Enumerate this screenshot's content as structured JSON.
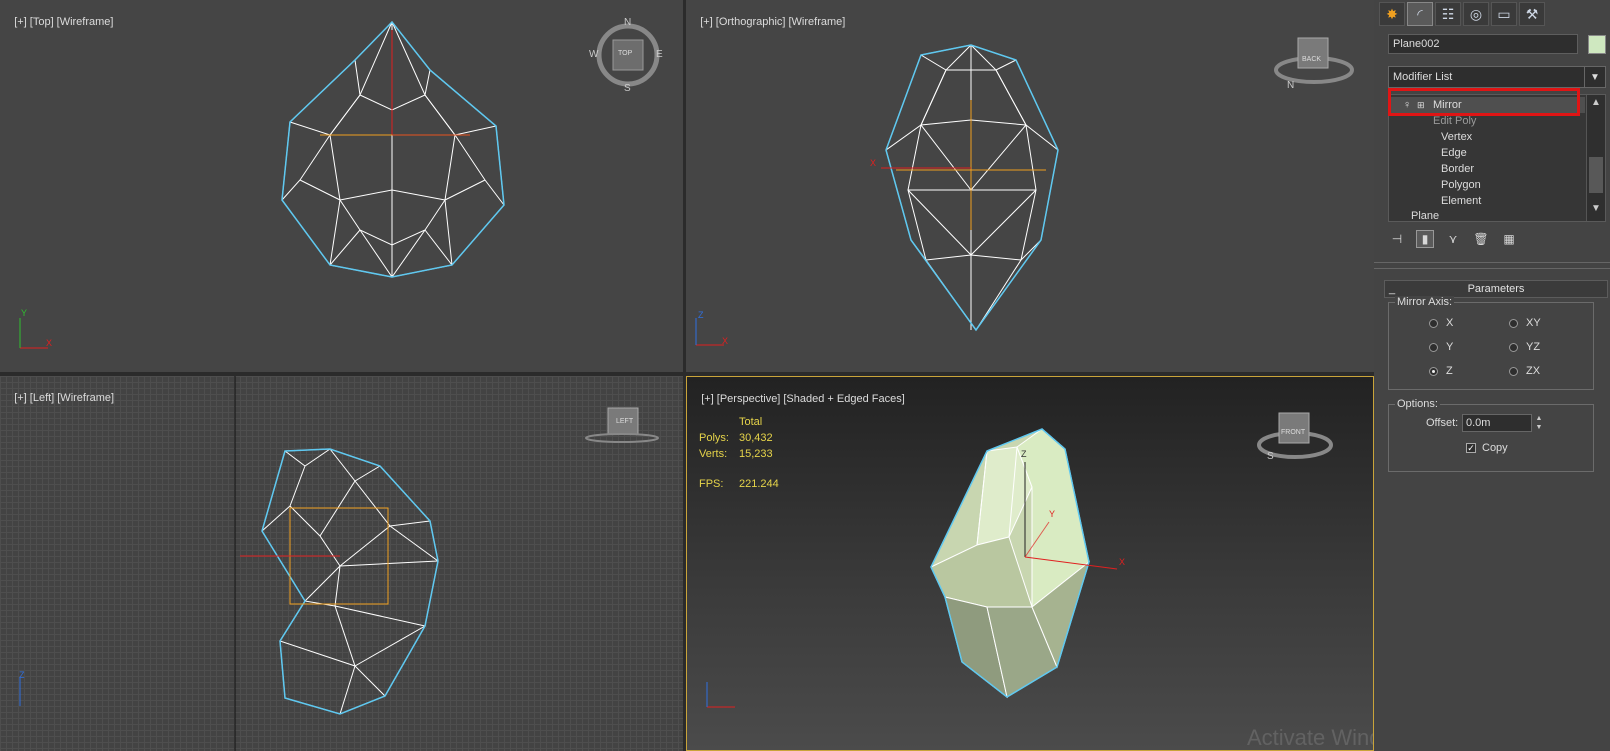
{
  "viewports": {
    "top": {
      "label": [
        "[+]",
        "[Top]",
        "[Wireframe]"
      ],
      "gizmo": {
        "n": "N",
        "s": "S",
        "e": "E",
        "w": "W",
        "cube": "TOP"
      },
      "axes": {
        "y": "Y",
        "x": "X"
      }
    },
    "ortho": {
      "label": [
        "[+]",
        "[Orthographic]",
        "[Wireframe]"
      ],
      "gizmo": {
        "n": "N",
        "cube": "BACK"
      },
      "axes": {
        "z": "Z",
        "x": "X"
      },
      "pivot_x": "X"
    },
    "left": {
      "label": [
        "[+]",
        "[Left]",
        "[Wireframe]"
      ],
      "gizmo": {
        "cube": "LEFT"
      },
      "axes": {
        "z": "Z"
      }
    },
    "persp": {
      "label": [
        "[+]",
        "[Perspective]",
        "[Shaded + Edged Faces]"
      ],
      "stats": {
        "header": "Total",
        "polys_label": "Polys:",
        "polys": "30,432",
        "verts_label": "Verts:",
        "verts": "15,233",
        "fps_label": "FPS:",
        "fps": "221.244"
      },
      "gizmo": {
        "cube": "FRONT",
        "s": "S"
      },
      "axes": {
        "z": "Z",
        "y": "Y",
        "x": "X"
      },
      "watermark": "Activate Windows"
    }
  },
  "panel": {
    "tabs": [
      {
        "icon": "create-icon",
        "glyph": "✸"
      },
      {
        "icon": "modify-icon",
        "glyph": "◜"
      },
      {
        "icon": "hierarchy-icon",
        "glyph": "☷"
      },
      {
        "icon": "motion-icon",
        "glyph": "◎"
      },
      {
        "icon": "display-icon",
        "glyph": "▭"
      },
      {
        "icon": "utilities-icon",
        "glyph": "⚒"
      }
    ],
    "object_name": "Plane002",
    "object_color": "#cfe8c0",
    "modifier_list": "Modifier List",
    "stack": [
      {
        "label": "Mirror",
        "level": 0
      },
      {
        "label": "Edit Poly",
        "level": 0
      },
      {
        "label": "Vertex",
        "level": 1
      },
      {
        "label": "Edge",
        "level": 1
      },
      {
        "label": "Border",
        "level": 1
      },
      {
        "label": "Polygon",
        "level": 1
      },
      {
        "label": "Element",
        "level": 1
      },
      {
        "label": "Plane",
        "level": 0
      }
    ],
    "rollout_title": "Parameters",
    "mirror_axis_title": "Mirror Axis:",
    "axes": [
      {
        "label": "X",
        "selected": false
      },
      {
        "label": "XY",
        "selected": false
      },
      {
        "label": "Y",
        "selected": false
      },
      {
        "label": "YZ",
        "selected": false
      },
      {
        "label": "Z",
        "selected": true
      },
      {
        "label": "ZX",
        "selected": false
      }
    ],
    "options_title": "Options:",
    "offset_label": "Offset:",
    "offset_value": "0.0m",
    "copy_label": "Copy",
    "copy_checked": true
  }
}
